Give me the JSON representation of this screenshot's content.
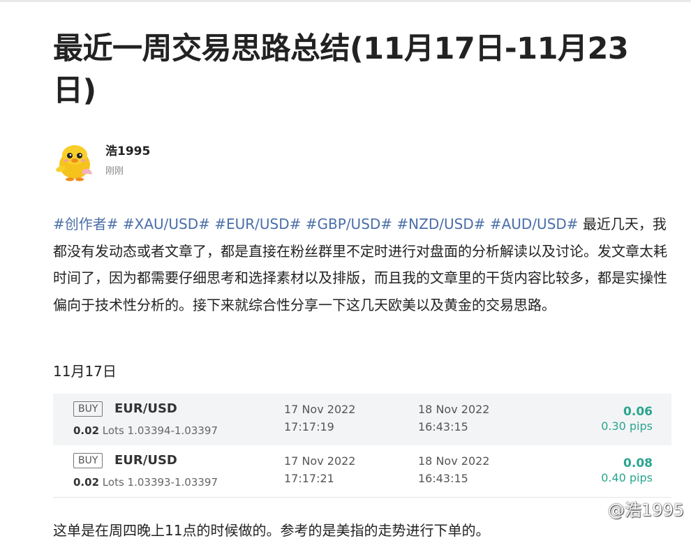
{
  "article": {
    "title": "最近一周交易思路总结(11月17日-11月23日)",
    "author": {
      "name": "浩1995",
      "time": "刚刚",
      "avatar_icon": "yellow-chick-cartoon-icon"
    },
    "intro": {
      "hashtags": [
        "#创作者#",
        "#XAU/USD#",
        "#EUR/USD#",
        "#GBP/USD#",
        "#NZD/USD#",
        "#AUD/USD#"
      ],
      "text": "最近几天，我都没有发动态或者文章了，都是直接在粉丝群里不定时进行对盘面的分析解读以及讨论。发文章太耗时间了，因为都需要仔细思考和选择素材以及排版，而且我的文章里的干货内容比较多，都是实操性偏向于技术性分析的。接下来就综合性分享一下这几天欧美以及黄金的交易思路。"
    },
    "date_label": "11月17日",
    "trades": [
      {
        "side": "BUY",
        "pair": "EUR/USD",
        "lots": "0.02",
        "lots_label": "Lots",
        "price_range": "1.03394-1.03397",
        "open_date": "17 Nov 2022",
        "open_time": "17:17:19",
        "close_date": "18 Nov 2022",
        "close_time": "16:43:15",
        "profit": "0.06",
        "pips": "0.30 pips"
      },
      {
        "side": "BUY",
        "pair": "EUR/USD",
        "lots": "0.02",
        "lots_label": "Lots",
        "price_range": "1.03393-1.03397",
        "open_date": "17 Nov 2022",
        "open_time": "17:17:21",
        "close_date": "18 Nov 2022",
        "close_time": "16:43:15",
        "profit": "0.08",
        "pips": "0.40 pips"
      }
    ],
    "followup": "这单是在周四晚上11点的时候做的。参考的是美指的走势进行下单的。"
  },
  "watermark": "@浩1995",
  "colors": {
    "hashtag": "#4a6ea8",
    "profit": "#2aa58f",
    "shaded_row": "#f3f4f6"
  }
}
